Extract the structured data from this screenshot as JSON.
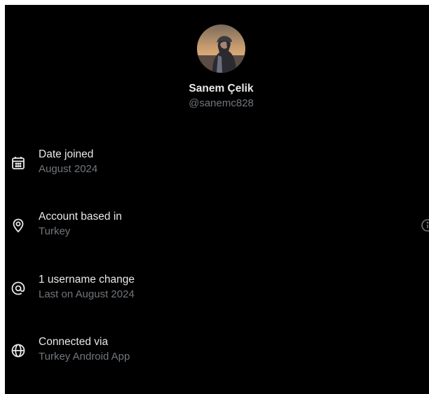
{
  "profile": {
    "display_name": "Sanem Çelik",
    "handle": "@sanemc828"
  },
  "rows": [
    {
      "icon": "calendar-icon",
      "title": "Date joined",
      "subtitle": "August 2024"
    },
    {
      "icon": "location-pin-icon",
      "title": "Account based in",
      "subtitle": "Turkey"
    },
    {
      "icon": "at-sign-icon",
      "title": "1 username change",
      "subtitle": "Last on August 2024"
    },
    {
      "icon": "globe-icon",
      "title": "Connected via",
      "subtitle": "Turkey Android App"
    }
  ],
  "colors": {
    "background": "#000000",
    "primary_text": "#e7e9ea",
    "secondary_text": "#71767b"
  }
}
